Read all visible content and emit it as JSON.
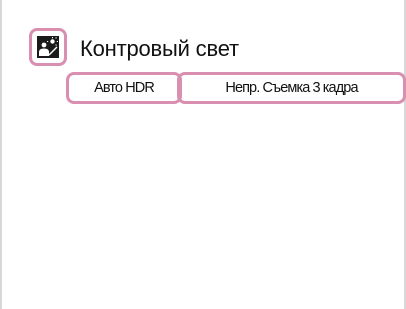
{
  "scene": {
    "icon": "backlight-scene-icon",
    "title": "Контровый свет"
  },
  "options": [
    {
      "label": "Авто HDR"
    },
    {
      "label": "Непр. Съемка 3 кадра"
    }
  ],
  "colors": {
    "highlight": "#d98fb0",
    "text": "#111111",
    "background": "#ffffff"
  }
}
